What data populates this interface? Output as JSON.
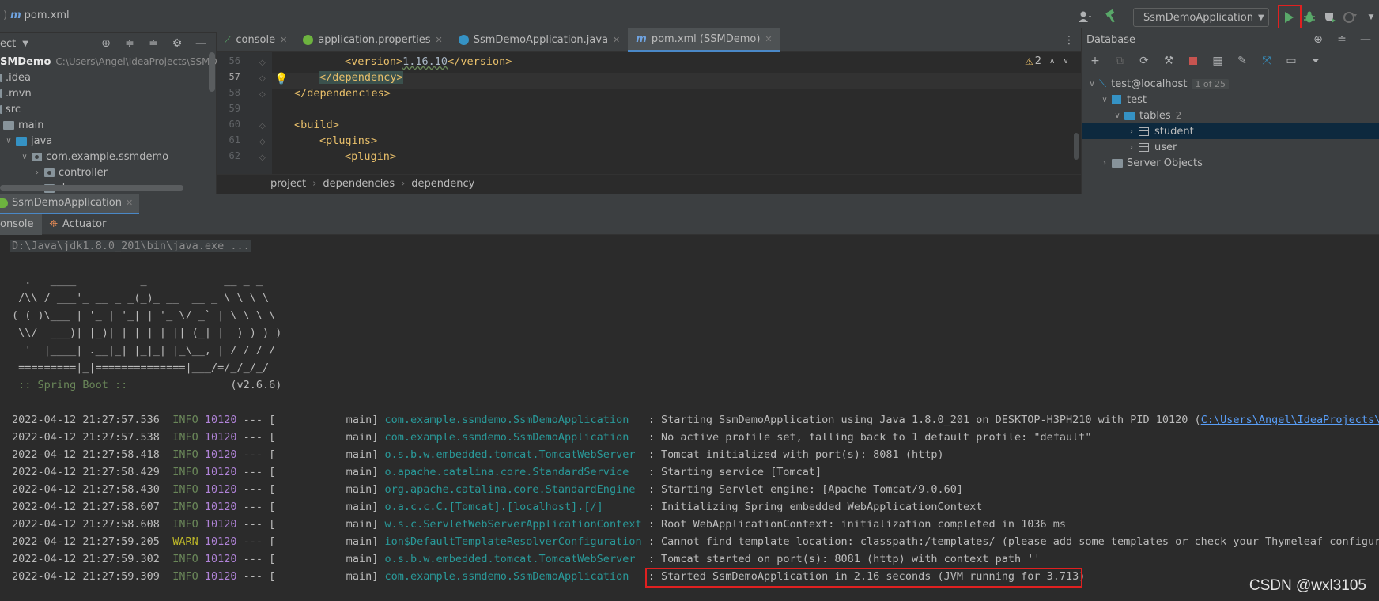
{
  "topbar": {
    "file": "pom.xml",
    "run_config": "SsmDemoApplication"
  },
  "project": {
    "header": "ect",
    "root_name": "SMDemo",
    "root_path": "C:\\Users\\Angel\\IdeaProjects\\SSMDem",
    "items": [
      {
        "label": ".idea"
      },
      {
        "label": ".mvn"
      },
      {
        "label": "src"
      },
      {
        "label": "main"
      },
      {
        "label": "java"
      },
      {
        "label": "com.example.ssmdemo"
      },
      {
        "label": "controller"
      },
      {
        "label": "dao"
      }
    ]
  },
  "editor": {
    "tabs": [
      {
        "label": "console"
      },
      {
        "label": "application.properties"
      },
      {
        "label": "SsmDemoApplication.java"
      },
      {
        "label": "pom.xml (SSMDemo)"
      }
    ],
    "warnings": "2",
    "lines": [
      {
        "num": "56",
        "open": "<version>",
        "text": "1.16.10",
        "close": "</version>"
      },
      {
        "num": "57",
        "open": "</dependency>",
        "text": "",
        "close": ""
      },
      {
        "num": "58",
        "open": "</dependencies>",
        "text": "",
        "close": ""
      },
      {
        "num": "59",
        "open": "",
        "text": "",
        "close": ""
      },
      {
        "num": "60",
        "open": "<build>",
        "text": "",
        "close": ""
      },
      {
        "num": "61",
        "open": "<plugins>",
        "text": "",
        "close": ""
      },
      {
        "num": "62",
        "open": "<plugin>",
        "text": "",
        "close": ""
      }
    ],
    "breadcrumb": [
      "project",
      "dependencies",
      "dependency"
    ]
  },
  "database": {
    "title": "Database",
    "connection": "test@localhost",
    "connection_badge": "1 of 25",
    "schema": "test",
    "tables_label": "tables",
    "tables_count": "2",
    "tables": [
      "student",
      "user"
    ],
    "server_objects": "Server Objects"
  },
  "run": {
    "tab": "SsmDemoApplication",
    "console_tab": "onsole",
    "actuator_tab": "Actuator",
    "command": "D:\\Java\\jdk1.8.0_201\\bin\\java.exe ...",
    "banner": [
      "  .   ____          _            __ _ _",
      " /\\\\ / ___'_ __ _ _(_)_ __  __ _ \\ \\ \\ \\",
      "( ( )\\___ | '_ | '_| | '_ \\/ _` | \\ \\ \\ \\",
      " \\\\/  ___)| |_)| | | | | || (_| |  ) ) ) )",
      "  '  |____| .__|_| |_|_| |_\\__, | / / / /",
      " =========|_|==============|___/=/_/_/_/"
    ],
    "spring_label": " :: Spring Boot :: ",
    "spring_version": "               (v2.6.6)",
    "logs": [
      {
        "ts": "2022-04-12 21:27:57.536",
        "level": "INFO",
        "pid": "10120",
        "sep": "--- [",
        "thread": "           main]",
        "logger": "com.example.ssmdemo.SsmDemoApplication  ",
        "msg": " : Starting SsmDemoApplication using Java 1.8.0_201 on DESKTOP-H3PH210 with PID 10120 (",
        "link": "C:\\Users\\Angel\\IdeaProjects\\SSM"
      },
      {
        "ts": "2022-04-12 21:27:57.538",
        "level": "INFO",
        "pid": "10120",
        "sep": "--- [",
        "thread": "           main]",
        "logger": "com.example.ssmdemo.SsmDemoApplication  ",
        "msg": " : No active profile set, falling back to 1 default profile: \"default\"",
        "link": ""
      },
      {
        "ts": "2022-04-12 21:27:58.418",
        "level": "INFO",
        "pid": "10120",
        "sep": "--- [",
        "thread": "           main]",
        "logger": "o.s.b.w.embedded.tomcat.TomcatWebServer ",
        "msg": " : Tomcat initialized with port(s): 8081 (http)",
        "link": ""
      },
      {
        "ts": "2022-04-12 21:27:58.429",
        "level": "INFO",
        "pid": "10120",
        "sep": "--- [",
        "thread": "           main]",
        "logger": "o.apache.catalina.core.StandardService  ",
        "msg": " : Starting service [Tomcat]",
        "link": ""
      },
      {
        "ts": "2022-04-12 21:27:58.430",
        "level": "INFO",
        "pid": "10120",
        "sep": "--- [",
        "thread": "           main]",
        "logger": "org.apache.catalina.core.StandardEngine ",
        "msg": " : Starting Servlet engine: [Apache Tomcat/9.0.60]",
        "link": ""
      },
      {
        "ts": "2022-04-12 21:27:58.607",
        "level": "INFO",
        "pid": "10120",
        "sep": "--- [",
        "thread": "           main]",
        "logger": "o.a.c.c.C.[Tomcat].[localhost].[/]      ",
        "msg": " : Initializing Spring embedded WebApplicationContext",
        "link": ""
      },
      {
        "ts": "2022-04-12 21:27:58.608",
        "level": "INFO",
        "pid": "10120",
        "sep": "--- [",
        "thread": "           main]",
        "logger": "w.s.c.ServletWebServerApplicationContext",
        "msg": " : Root WebApplicationContext: initialization completed in 1036 ms",
        "link": ""
      },
      {
        "ts": "2022-04-12 21:27:59.205",
        "level": "WARN",
        "pid": "10120",
        "sep": "--- [",
        "thread": "           main]",
        "logger": "ion$DefaultTemplateResolverConfiguration",
        "msg": " : Cannot find template location: classpath:/templates/ (please add some templates or check your Thymeleaf configurati",
        "link": ""
      },
      {
        "ts": "2022-04-12 21:27:59.302",
        "level": "INFO",
        "pid": "10120",
        "sep": "--- [",
        "thread": "           main]",
        "logger": "o.s.b.w.embedded.tomcat.TomcatWebServer ",
        "msg": " : Tomcat started on port(s): 8081 (http) with context path ''",
        "link": ""
      },
      {
        "ts": "2022-04-12 21:27:59.309",
        "level": "INFO",
        "pid": "10120",
        "sep": "--- [",
        "thread": "           main]",
        "logger": "com.example.ssmdemo.SsmDemoApplication  ",
        "msg": " : Started SsmDemoApplication in 2.16 seconds (JVM running for 3.713)",
        "link": ""
      }
    ]
  },
  "watermark": "CSDN @wxl3105",
  "colors": {
    "highlight_box": "#e02020",
    "run_green": "#59a869",
    "active_tab_underline": "#4a88c7"
  }
}
